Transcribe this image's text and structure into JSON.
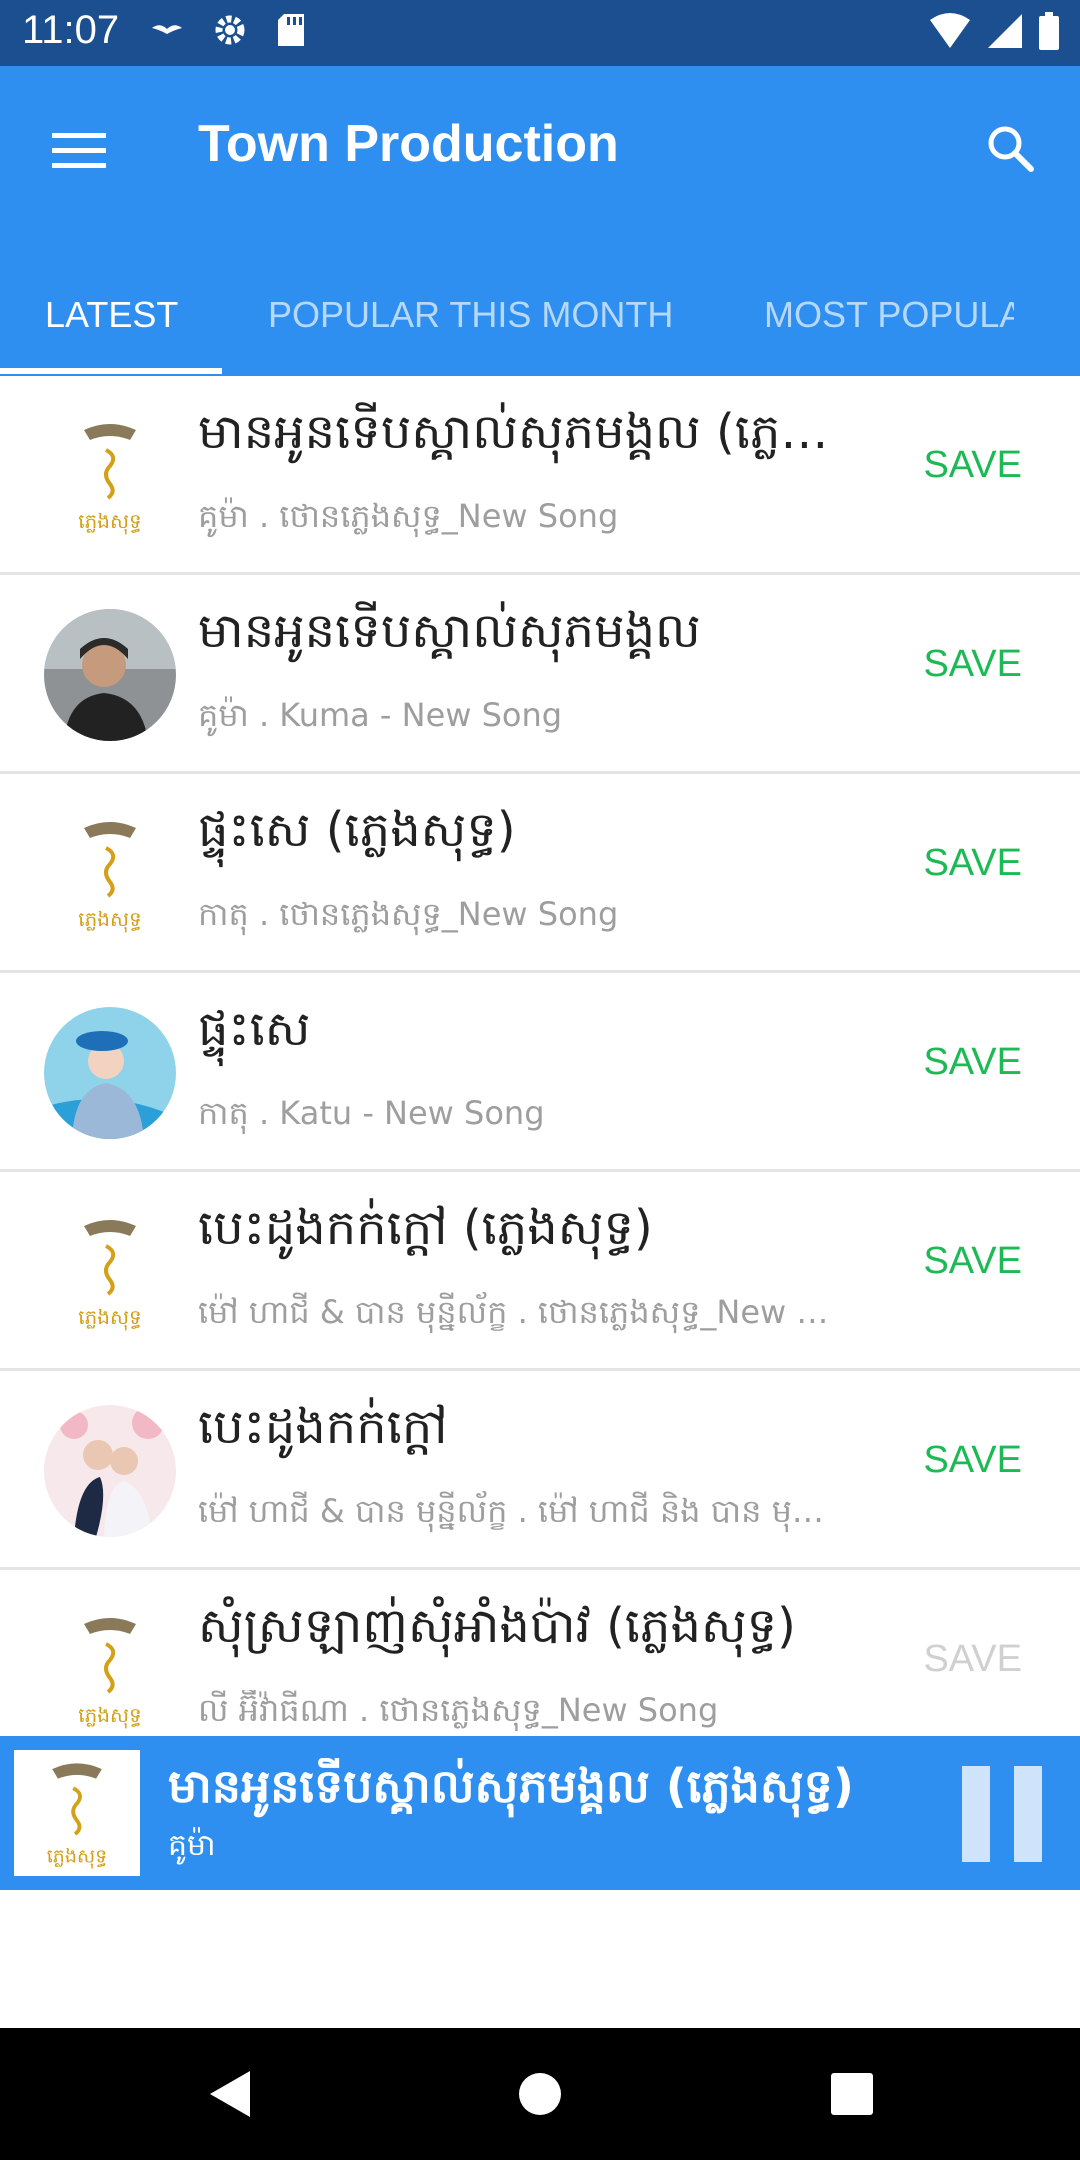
{
  "status_bar": {
    "time": "11:07"
  },
  "app_bar": {
    "title": "Town Production"
  },
  "tabs": [
    {
      "label": "LATEST",
      "active": true
    },
    {
      "label": "POPULAR THIS MONTH",
      "active": false
    },
    {
      "label": "MOST POPULAR",
      "active": false
    }
  ],
  "songs": [
    {
      "title": "មានអូនទើបស្គាល់សុភមង្គល (ភ្លេងសុទ្ធ)",
      "subtitle": "គូម៉ា . ថោនភ្លេងសុទ្ធ_New Song",
      "save_label": "SAVE",
      "thumb": "town-logo"
    },
    {
      "title": "មានអូនទើបស្គាល់សុភមង្គល",
      "subtitle": "គូម៉ា . Kuma - New Song",
      "save_label": "SAVE",
      "thumb": "artist-photo"
    },
    {
      "title": "ផ្ទុះសេ (ភ្លេងសុទ្ធ)",
      "subtitle": "កាតុ . ថោនភ្លេងសុទ្ធ_New Song",
      "save_label": "SAVE",
      "thumb": "town-logo"
    },
    {
      "title": "ផ្ទុះសេ",
      "subtitle": "កាតុ . Katu - New Song",
      "save_label": "SAVE",
      "thumb": "artist-photo"
    },
    {
      "title": "បេះដូងកក់ក្ដៅ (ភ្លេងសុទ្ធ)",
      "subtitle": "ម៉ៅ ហាជី & បាន មុន្នីល័ក្ខ . ថោនភ្លេងសុទ្ធ_New Song",
      "save_label": "SAVE",
      "thumb": "town-logo"
    },
    {
      "title": "បេះដូងកក់ក្ដៅ",
      "subtitle": "ម៉ៅ ហាជី & បាន មុន្នីល័ក្ខ . ម៉ៅ ហាជី និង បាន មុន្នីល័ក្ខ",
      "save_label": "SAVE",
      "thumb": "artist-photo"
    },
    {
      "title": "សុំស្រឡាញ់សុំអាំងប៉ាវ (ភ្លេងសុទ្ធ)",
      "subtitle": "លី អ៊ីវ៉ាធីណា . ថោនភ្លេងសុទ្ធ_New Song",
      "save_label": "SAVE",
      "thumb": "town-logo"
    }
  ],
  "player": {
    "title": "មានអូនទើបស្គាល់សុភមង្គល (ភ្លេងសុទ្ធ)",
    "artist": "គូម៉ា",
    "state": "playing"
  },
  "colors": {
    "status_bar": "#1b4f8f",
    "primary": "#2f8ff0",
    "save": "#1db954"
  }
}
